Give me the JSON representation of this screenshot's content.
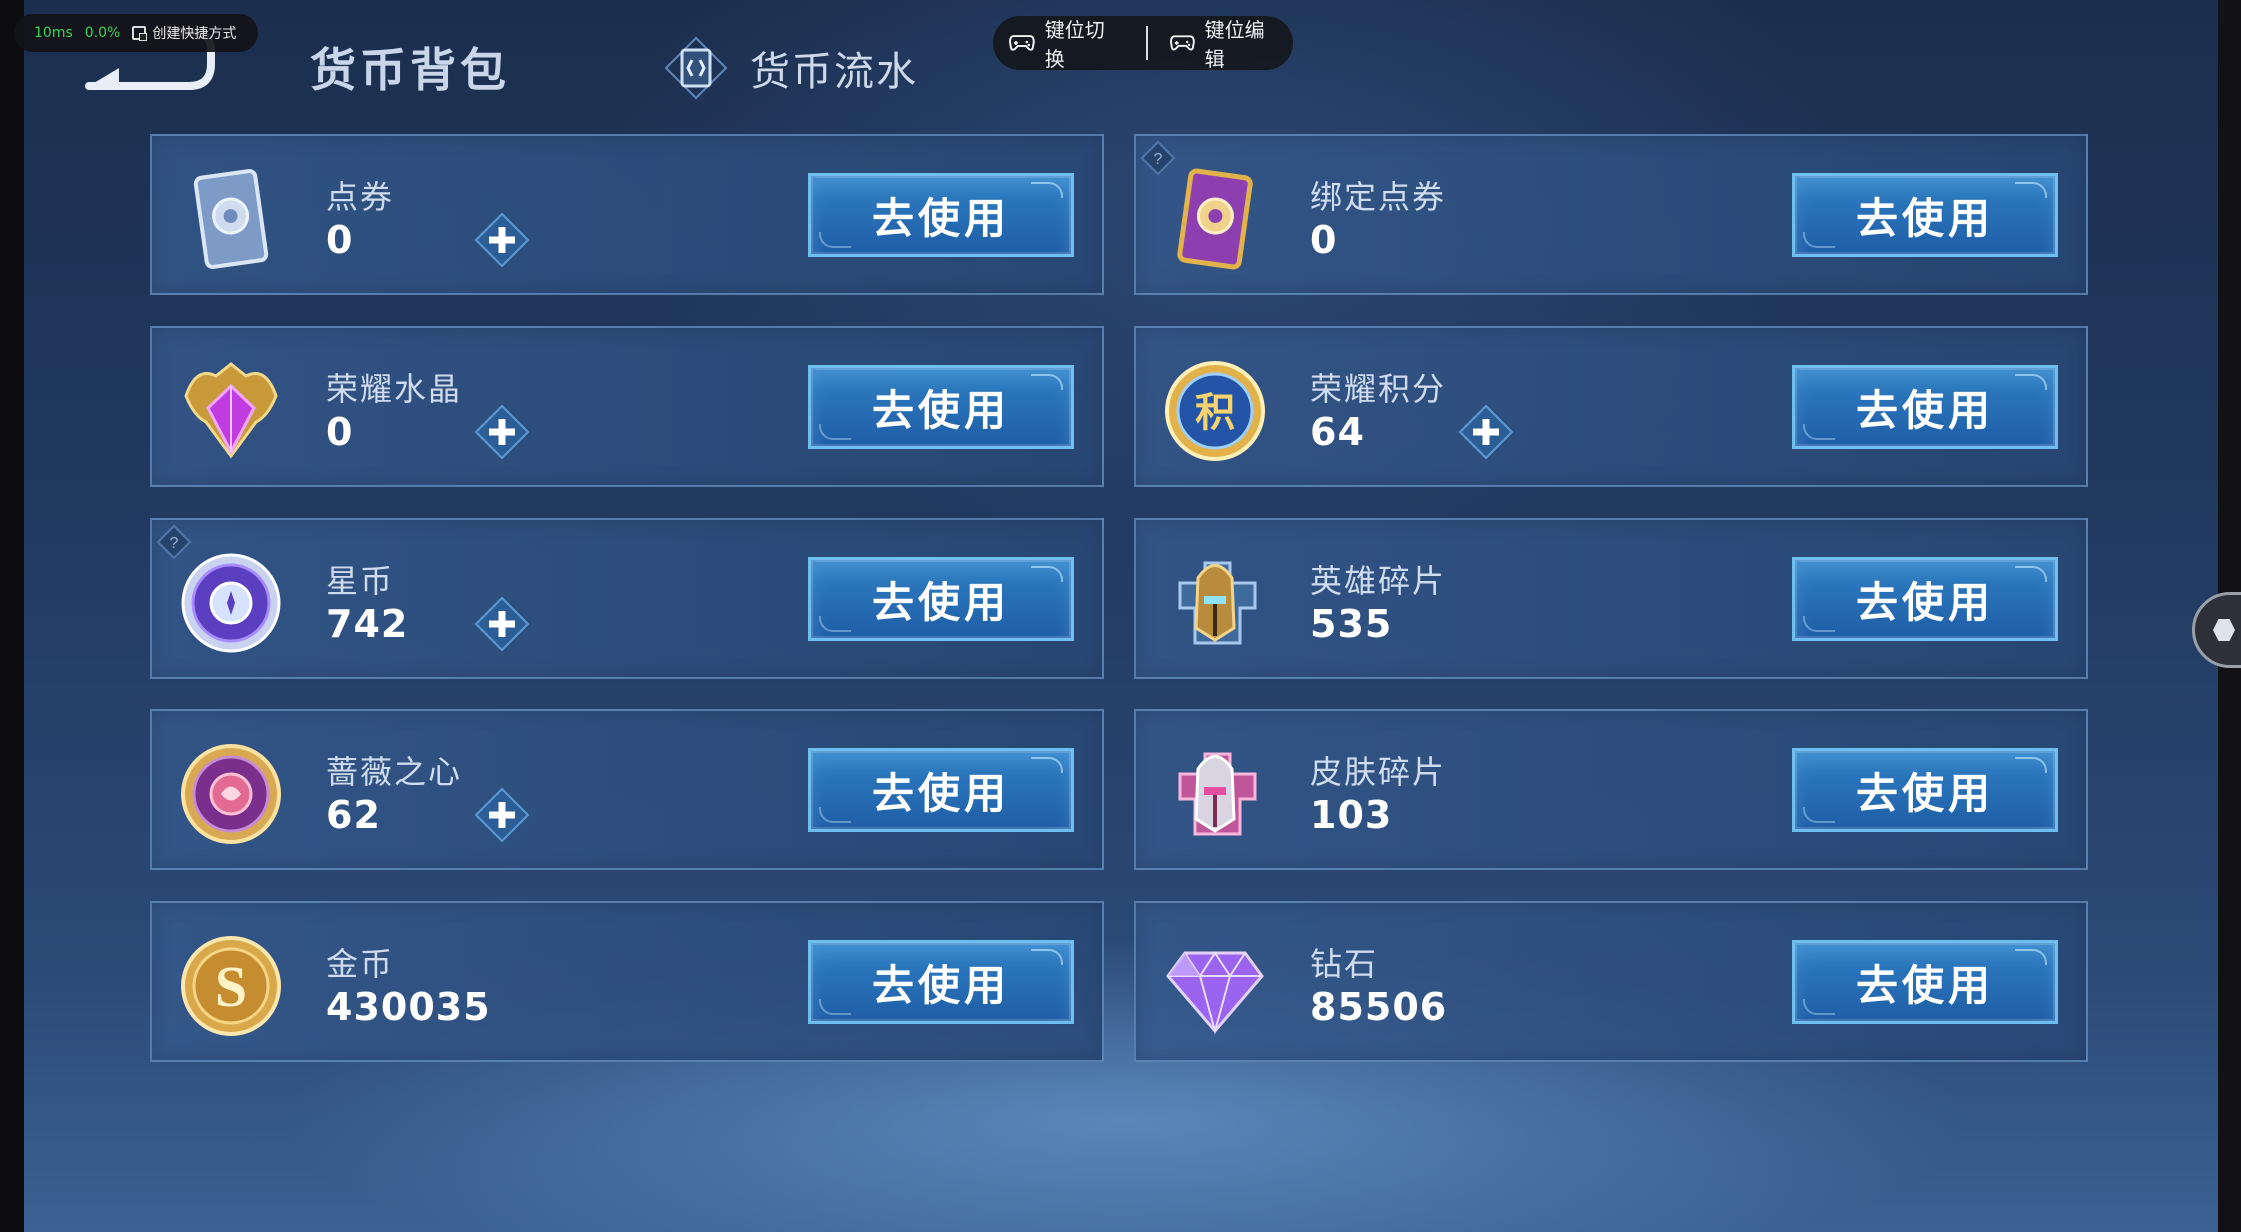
{
  "overlay": {
    "latency": "10ms",
    "usage": "0.0%",
    "shortcut_label": "创建快捷方式"
  },
  "header": {
    "title": "货币背包",
    "tab_flow_label": "货币流水"
  },
  "controls": {
    "key_switch": "键位切换",
    "key_edit": "键位编辑"
  },
  "colors": {
    "button_blue": "#2f7fc4",
    "button_border": "#6fbef0",
    "card_border": "#78a5d7"
  },
  "currencies": [
    {
      "name": "点券",
      "amount": "0",
      "button": "去使用",
      "icon": "coupon-card-icon"
    },
    {
      "name": "绑定点券",
      "amount": "0",
      "button": "去使用",
      "icon": "bound-coupon-card-icon"
    },
    {
      "name": "荣耀水晶",
      "amount": "0",
      "button": "去使用",
      "icon": "glory-crystal-icon"
    },
    {
      "name": "荣耀积分",
      "amount": "64",
      "button": "去使用",
      "icon": "glory-points-icon"
    },
    {
      "name": "星币",
      "amount": "742",
      "button": "去使用",
      "icon": "star-coin-icon"
    },
    {
      "name": "英雄碎片",
      "amount": "535",
      "button": "去使用",
      "icon": "hero-fragment-icon"
    },
    {
      "name": "蔷薇之心",
      "amount": "62",
      "button": "去使用",
      "icon": "rose-heart-icon"
    },
    {
      "name": "皮肤碎片",
      "amount": "103",
      "button": "去使用",
      "icon": "skin-fragment-icon"
    },
    {
      "name": "金币",
      "amount": "430035",
      "button": "去使用",
      "icon": "gold-coin-icon"
    },
    {
      "name": "钻石",
      "amount": "85506",
      "button": "去使用",
      "icon": "diamond-icon"
    }
  ]
}
